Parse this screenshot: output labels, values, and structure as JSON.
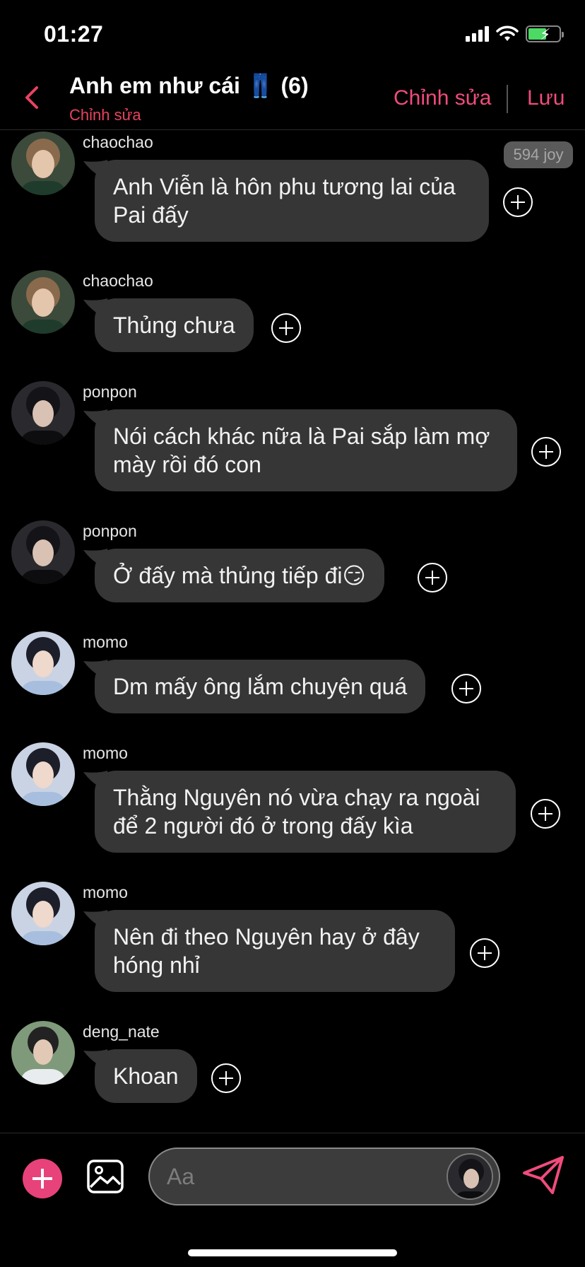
{
  "status_bar": {
    "time": "01:27"
  },
  "header": {
    "title": "Anh em như cái 👖 (6)",
    "subtitle": "Chỉnh sửa",
    "edit_label": "Chỉnh sửa",
    "save_label": "Lưu"
  },
  "joy_badge": "594 joy",
  "messages": [
    {
      "sender": "chaochao",
      "text": "Anh Viễn là hôn phu tương lai của Pai đấy"
    },
    {
      "sender": "chaochao",
      "text": "Thủng chưa"
    },
    {
      "sender": "ponpon",
      "text": "Nói cách khác nữa là Pai sắp làm mợ mày rồi đó con"
    },
    {
      "sender": "ponpon",
      "text": "Ở đấy mà thủng tiếp đi😏"
    },
    {
      "sender": "momo",
      "text": "Dm mấy ông lắm chuyện quá"
    },
    {
      "sender": "momo",
      "text": "Thằng Nguyên nó vừa chạy ra ngoài để 2 người đó ở trong đấy kìa"
    },
    {
      "sender": "momo",
      "text": "Nên đi theo Nguyên hay ở đây hóng nhỉ"
    },
    {
      "sender": "deng_nate",
      "text": "Khoan"
    }
  ],
  "composer": {
    "placeholder": "Aa",
    "value": ""
  },
  "colors": {
    "accent": "#ef4c7c",
    "bubble": "#363636",
    "background": "#000000",
    "battery": "#4cd964"
  },
  "icons": {
    "back": "chevron-left-icon",
    "plus": "plus-icon",
    "image": "image-icon",
    "send": "send-icon",
    "add_reaction": "add-circle-icon"
  }
}
